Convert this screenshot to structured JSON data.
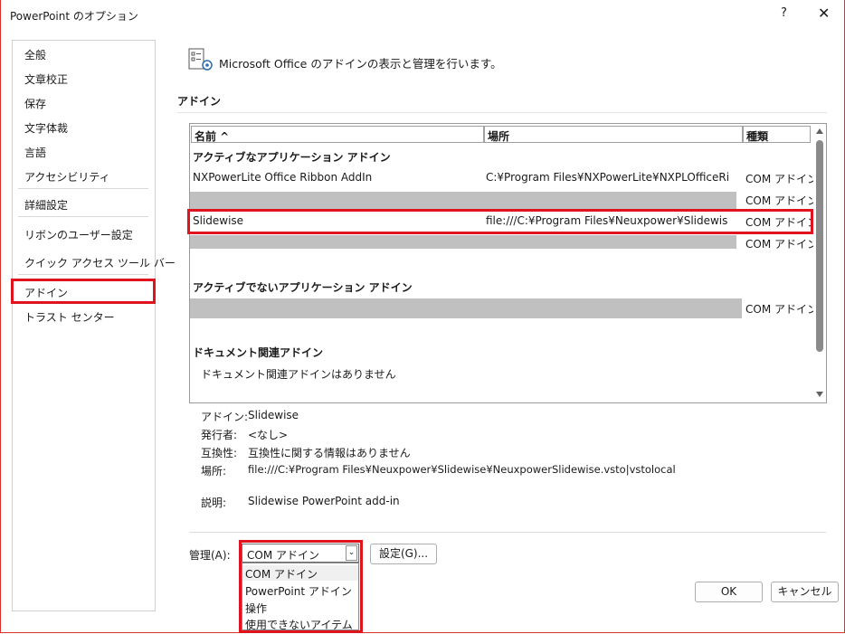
{
  "window": {
    "title": "PowerPoint のオプション",
    "help_label": "?",
    "close_label": "✕"
  },
  "sidebar": {
    "items": [
      {
        "label": "全般"
      },
      {
        "label": "文章校正"
      },
      {
        "label": "保存"
      },
      {
        "label": "文字体裁"
      },
      {
        "label": "言語"
      },
      {
        "label": "アクセシビリティ"
      },
      {
        "label": "詳細設定"
      },
      {
        "label": "リボンのユーザー設定"
      },
      {
        "label": "クイック アクセス ツール バー"
      },
      {
        "label": "アドイン"
      },
      {
        "label": "トラスト センター"
      }
    ],
    "selected": "アドイン"
  },
  "header": {
    "icon": "addin-settings-icon",
    "text": "Microsoft Office のアドインの表示と管理を行います。"
  },
  "section": {
    "title": "アドイン"
  },
  "table": {
    "columns": [
      "名前 ^",
      "場所",
      "種類"
    ],
    "groups": {
      "active": "アクティブなアプリケーション アドイン",
      "inactive": "アクティブでないアプリケーション アドイン",
      "document": "ドキュメント関連アドイン"
    },
    "rows": [
      {
        "name": "NXPowerLite Office Ribbon AddIn",
        "location": "C:¥Program Files¥NXPowerLite¥NXPLOfficeRi",
        "type": "COM アドイン"
      },
      {
        "name": "",
        "location": "",
        "type": "COM アドイン"
      },
      {
        "name": "Slidewise",
        "location": "file:///C:¥Program Files¥Neuxpower¥Slidewis",
        "type": "COM アドイン"
      },
      {
        "name": "",
        "location": "",
        "type": "COM アドイン"
      },
      {
        "name": "",
        "location": "",
        "type": "COM アドイン"
      }
    ],
    "document_empty": "ドキュメント関連アドインはありません"
  },
  "details": {
    "addin_label": "アドイン:",
    "addin_value": "Slidewise",
    "publisher_label": "発行者:",
    "publisher_value": "<なし>",
    "compat_label": "互換性:",
    "compat_value": "互換性に関する情報はありません",
    "location_label": "場所:",
    "location_value": "file:///C:¥Program Files¥Neuxpower¥Slidewise¥NeuxpowerSlidewise.vsto|vstolocal",
    "desc_label": "説明:",
    "desc_value": "Slidewise PowerPoint add-in"
  },
  "manage": {
    "label": "管理(A):",
    "selected": "COM アドイン",
    "options": [
      "COM アドイン",
      "PowerPoint アドイン",
      "操作",
      "使用できないアイテム"
    ],
    "settings_button": "設定(G)..."
  },
  "footer": {
    "ok": "OK",
    "cancel": "キャンセル"
  },
  "colors": {
    "highlight": "#e0141e",
    "grayrow": "#c0c0c0"
  }
}
